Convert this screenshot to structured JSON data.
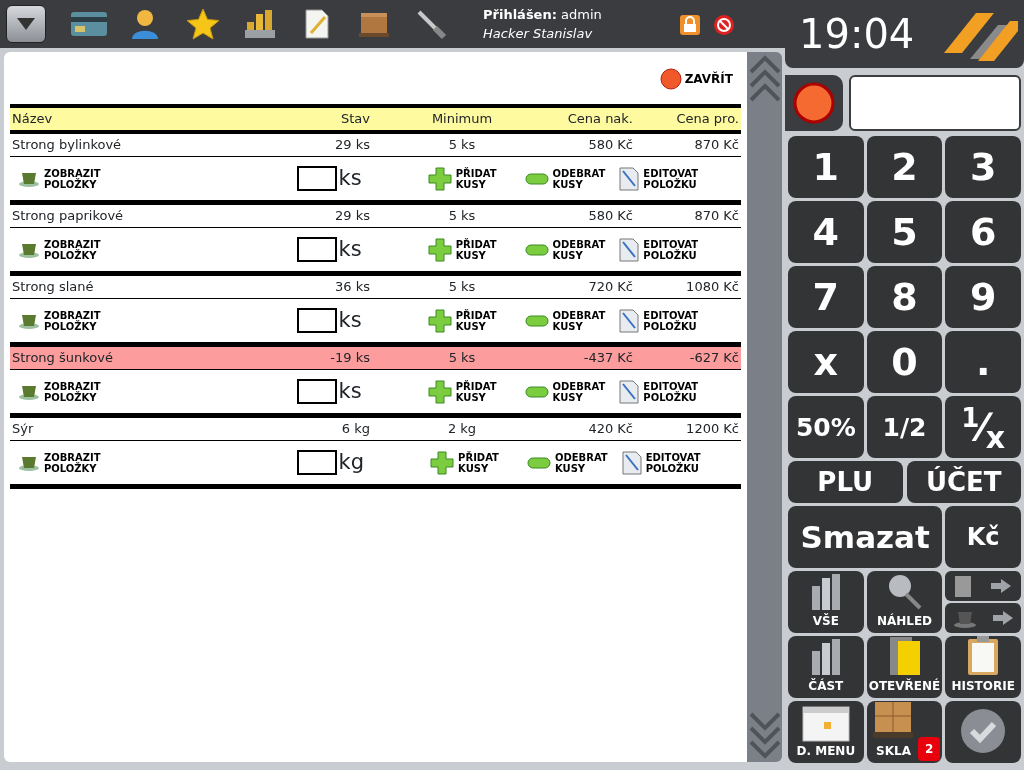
{
  "toolbar": [
    {
      "kind": "card"
    },
    {
      "kind": "person"
    },
    {
      "kind": "star"
    },
    {
      "kind": "coins"
    },
    {
      "kind": "note"
    },
    {
      "kind": "box"
    },
    {
      "kind": "tool"
    }
  ],
  "login": {
    "label": "Přihlášen:",
    "user": "admin",
    "name": "Hacker Stanislav"
  },
  "clock": "19:04",
  "close_button": "ZAVŘÍT",
  "table": {
    "columns": [
      "Název",
      "Stav",
      "Minimum",
      "Cena nak.",
      "Cena pro."
    ],
    "rows": [
      {
        "name": "Strong bylinkové",
        "stock": "29 ks",
        "minimum": "5 ks",
        "cost": "580 Kč",
        "price": "870 Kč",
        "alert": false,
        "unit": "ks",
        "actions": [
          [
            "ZOBRAZIT",
            "POLOŽKY"
          ],
          [
            "PŘIDAT",
            "KUSY"
          ],
          [
            "ODEBRAT",
            "KUSY"
          ],
          [
            "EDITOVAT",
            "POLOŽKU"
          ]
        ]
      },
      {
        "name": "Strong paprikové",
        "stock": "29 ks",
        "minimum": "5 ks",
        "cost": "580 Kč",
        "price": "870 Kč",
        "alert": false,
        "unit": "ks",
        "actions": [
          [
            "ZOBRAZIT",
            "POLOŽKY"
          ],
          [
            "PŘIDAT",
            "KUSY"
          ],
          [
            "ODEBRAT",
            "KUSY"
          ],
          [
            "EDITOVAT",
            "POLOŽKU"
          ]
        ]
      },
      {
        "name": "Strong slané",
        "stock": "36 ks",
        "minimum": "5 ks",
        "cost": "720 Kč",
        "price": "1080 Kč",
        "alert": false,
        "unit": "ks",
        "actions": [
          [
            "ZOBRAZIT",
            "POLOŽKY"
          ],
          [
            "PŘIDAT",
            "KUSY"
          ],
          [
            "ODEBRAT",
            "KUSY"
          ],
          [
            "EDITOVAT",
            "POLOŽKU"
          ]
        ]
      },
      {
        "name": "Strong šunkové",
        "stock": "-19 ks",
        "minimum": "5 ks",
        "cost": "-437 Kč",
        "price": "-627 Kč",
        "alert": true,
        "unit": "ks",
        "actions": [
          [
            "ZOBRAZIT",
            "POLOŽKY"
          ],
          [
            "PŘIDAT",
            "KUSY"
          ],
          [
            "ODEBRAT",
            "KUSY"
          ],
          [
            "EDITOVAT",
            "POLOŽKU"
          ]
        ]
      },
      {
        "name": "Sýr",
        "stock": "6 kg",
        "minimum": "2 kg",
        "cost": "420 Kč",
        "price": "1200 Kč",
        "alert": false,
        "unit": "kg",
        "actions": [
          [
            "ZOBRAZIT",
            "POLOŽKY"
          ],
          [
            "PŘIDAT",
            "KUSY"
          ],
          [
            "ODEBRAT",
            "KUSY"
          ],
          [
            "EDITOVAT",
            "POLOŽKU"
          ]
        ]
      }
    ]
  },
  "keypad": [
    [
      {
        "label": "1"
      },
      {
        "label": "2"
      },
      {
        "label": "3"
      }
    ],
    [
      {
        "label": "4"
      },
      {
        "label": "5"
      },
      {
        "label": "6"
      }
    ],
    [
      {
        "label": "7"
      },
      {
        "label": "8"
      },
      {
        "label": "9"
      }
    ],
    [
      {
        "label": "x"
      },
      {
        "label": "0"
      },
      {
        "label": "."
      }
    ],
    [
      {
        "label": "50%",
        "small": true
      },
      {
        "label": "1/2",
        "small": true
      },
      {
        "label": "$^{1}$⁄$_{x}$",
        "small": false
      }
    ]
  ],
  "function_keys": [
    {
      "label": "PLU"
    },
    {
      "label": "ÚČET"
    }
  ],
  "clear_keys": [
    {
      "label": "Smazat",
      "wide": true
    },
    {
      "label": "Kč",
      "wide": false
    }
  ],
  "tools": [
    {
      "kind": "bottles",
      "label": "VŠE"
    },
    {
      "kind": "magnifier",
      "label": "NÁHLED"
    },
    {
      "kind": "split"
    },
    {
      "kind": "bottles",
      "label": "ČÁST"
    },
    {
      "kind": "folder",
      "label": "OTEVŘENÉ"
    },
    {
      "kind": "clipboard",
      "label": "HISTORIE"
    },
    {
      "kind": "calendar",
      "label": "D. MENU"
    },
    {
      "kind": "pallet",
      "label": "SKLA",
      "badge": "2"
    },
    {
      "kind": "confirm"
    }
  ]
}
